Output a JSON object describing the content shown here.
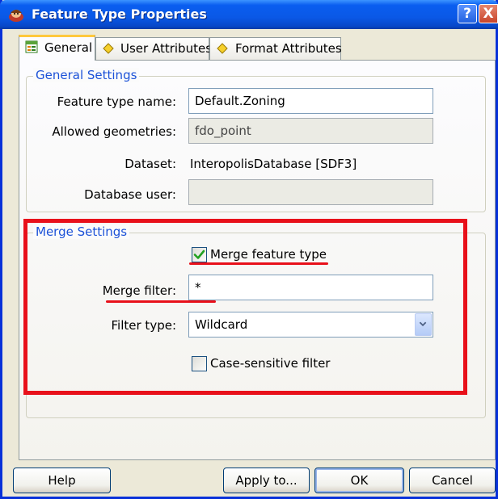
{
  "window": {
    "title": "Feature Type Properties",
    "help_glyph": "?",
    "close_glyph": "X"
  },
  "tabs": [
    {
      "label": "General",
      "icon": "form-icon",
      "active": true
    },
    {
      "label": "User Attributes",
      "icon": "diamond-icon",
      "active": false
    },
    {
      "label": "Format Attributes",
      "icon": "diamond-icon",
      "active": false
    }
  ],
  "general_settings": {
    "legend": "General Settings",
    "feature_type_name": {
      "label": "Feature type name:",
      "value": "Default.Zoning"
    },
    "allowed_geometries": {
      "label": "Allowed geometries:",
      "value": "fdo_point"
    },
    "dataset": {
      "label": "Dataset:",
      "value": "InteropolisDatabase [SDF3]"
    },
    "database_user": {
      "label": "Database user:",
      "value": ""
    }
  },
  "merge_settings": {
    "legend": "Merge Settings",
    "merge_feature_type": {
      "label": "Merge feature type",
      "checked": true
    },
    "merge_filter": {
      "label": "Merge filter:",
      "value": "*"
    },
    "filter_type": {
      "label": "Filter type:",
      "value": "Wildcard"
    },
    "case_sensitive": {
      "label": "Case-sensitive filter",
      "checked": false
    }
  },
  "buttons": {
    "help": "Help",
    "apply_to": "Apply to...",
    "ok": "OK",
    "cancel": "Cancel"
  },
  "colors": {
    "annotation": "#e8101a",
    "legend": "#1c52d8",
    "titlebar": "#0a58e6"
  }
}
